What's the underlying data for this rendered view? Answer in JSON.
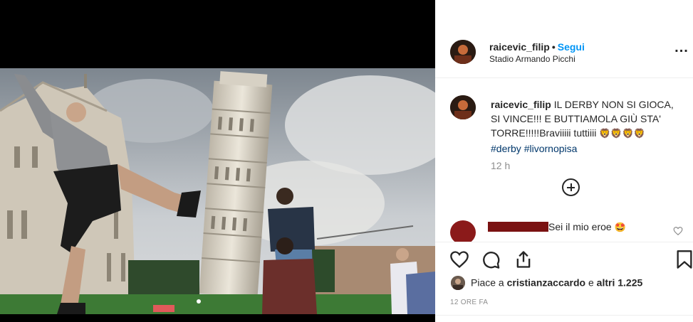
{
  "post": {
    "username": "raicevic_filip",
    "separator": "•",
    "follow_label": "Segui",
    "location": "Stadio Armando Picchi",
    "more_label": "..."
  },
  "caption": {
    "username": "raicevic_filip",
    "text": "IL DERBY NON SI GIOCA, SI VINCE!!! E BUTTIAMOLA GIÙ STA' TORRE!!!!!Braviiiii tuttiiii",
    "emoji": "🦁🦁🦁🦁",
    "hashtags": [
      "#derby",
      "#livornopisa"
    ],
    "time": "12 h"
  },
  "comments": [
    {
      "text": "Sei il mio eroe",
      "emoji": "🤩"
    }
  ],
  "likes": {
    "prefix": "Piace a",
    "user": "cristianzaccardo",
    "middle": "e",
    "others": "altri 1.225"
  },
  "date": "12 ORE FA",
  "icons": {
    "like": "heart-icon",
    "comment": "comment-icon",
    "share": "share-icon",
    "save": "bookmark-icon",
    "load_more": "plus-circle-icon",
    "more": "more-icon"
  },
  "colors": {
    "accent": "#0095f6",
    "hashtag": "#00376b",
    "muted": "#8e8e8e"
  }
}
